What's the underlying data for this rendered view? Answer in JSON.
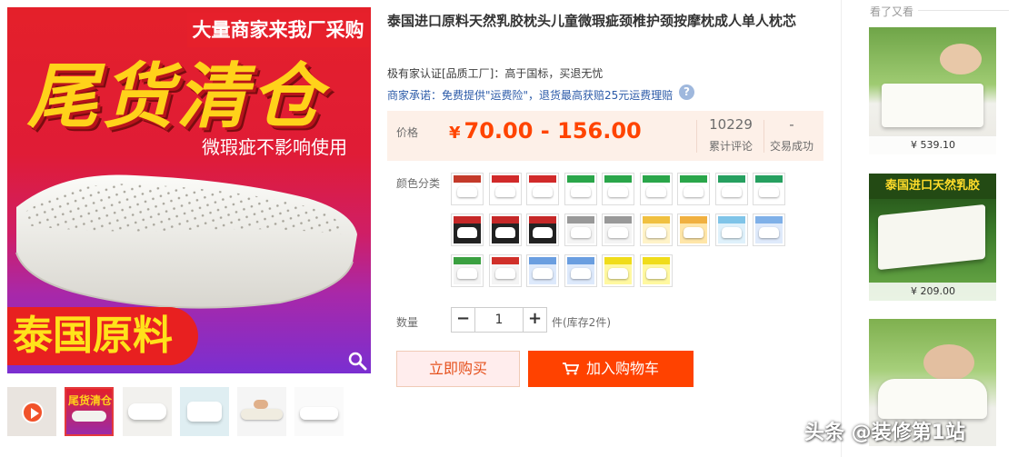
{
  "main_image": {
    "banner_top": "大量商家来我厂采购",
    "big_title": "尾货清仓",
    "sub_title": "微瑕疵不影响使用",
    "origin_badge": "泰国原料"
  },
  "thumbnails": [
    {
      "kind": "video"
    },
    {
      "kind": "image",
      "label": "尾货清仓",
      "active": true
    },
    {
      "kind": "image"
    },
    {
      "kind": "image"
    },
    {
      "kind": "image"
    },
    {
      "kind": "image"
    }
  ],
  "product": {
    "title": "泰国进口原料天然乳胶枕头儿童微瑕疵颈椎护颈按摩枕成人单人枕芯",
    "cert": "极有家认证[品质工厂]：高于国标，买退无忧",
    "promise": "商家承诺：免费提供\"运费险\"，退货最高获赔25元运费理赔",
    "help_icon": "?",
    "price_label": "价格",
    "currency": "¥",
    "price_range": "70.00 - 156.00",
    "reviews_count": "10229",
    "reviews_label": "累计评论",
    "deals_count": "-",
    "deals_label": "交易成功",
    "color_label": "颜色分类",
    "quantity_label": "数量",
    "quantity_value": "1",
    "minus": "−",
    "plus": "+",
    "stock_text": "件(库存2件)",
    "buy_now": "立即购买",
    "add_cart": "加入购物车"
  },
  "swatches": [
    {
      "strip": "#c43a2a",
      "bg": "#ffffff"
    },
    {
      "strip": "#d12a2a",
      "bg": "#ffffff"
    },
    {
      "strip": "#d12a2a",
      "bg": "#ffffff"
    },
    {
      "strip": "#2aa64a",
      "bg": "#ffffff"
    },
    {
      "strip": "#2aa64a",
      "bg": "#ffffff"
    },
    {
      "strip": "#2aa64a",
      "bg": "#ffffff"
    },
    {
      "strip": "#2aa64a",
      "bg": "#ffffff"
    },
    {
      "strip": "#26a060",
      "bg": "#ffffff"
    },
    {
      "strip": "#26a060",
      "bg": "#ffffff"
    },
    {
      "strip": "#c62828",
      "bg": "#222222"
    },
    {
      "strip": "#c62828",
      "bg": "#222222"
    },
    {
      "strip": "#c62828",
      "bg": "#222222"
    },
    {
      "strip": "#999999",
      "bg": "#f4f4f4"
    },
    {
      "strip": "#999999",
      "bg": "#f4f4f4"
    },
    {
      "strip": "#f0c040",
      "bg": "#fff3c8"
    },
    {
      "strip": "#f0b040",
      "bg": "#ffe6a8"
    },
    {
      "strip": "#7fc4e8",
      "bg": "#dff1fb"
    },
    {
      "strip": "#7fb0e8",
      "bg": "#dfeafb"
    },
    {
      "strip": "#3aa040",
      "bg": "#f4f4f4"
    },
    {
      "strip": "#d0302a",
      "bg": "#f4f4f4"
    },
    {
      "strip": "#6a9ee0",
      "bg": "#dde9fb"
    },
    {
      "strip": "#6a9ee0",
      "bg": "#dde9fb"
    },
    {
      "strip": "#f0dc1a",
      "bg": "#fff8a0"
    },
    {
      "strip": "#f0dc1a",
      "bg": "#fff8a0"
    }
  ],
  "rail": {
    "title": "看了又看",
    "items": [
      {
        "price": "¥ 539.10"
      },
      {
        "banner": "泰国进口天然乳胶",
        "price": "¥ 209.00"
      },
      {}
    ]
  },
  "watermark": "头条 @装修第1站",
  "colors": {
    "accent_orange": "#ff4200",
    "price_red": "#ff4400",
    "promise_blue": "#2b5aa8",
    "price_bg": "#fdf0e8",
    "buy_bg": "#ffeded"
  }
}
